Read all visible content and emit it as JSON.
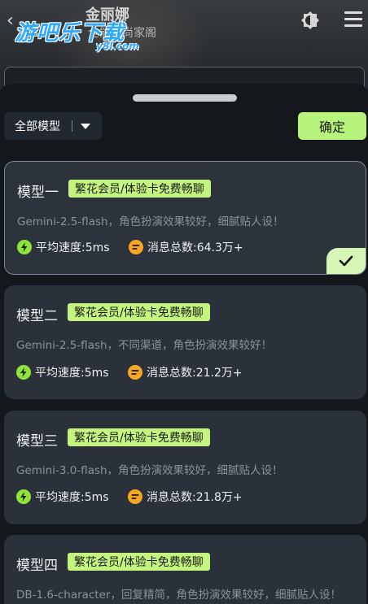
{
  "header": {
    "character_name": "金丽娜",
    "character_sub": "全能时尚家阁",
    "watermark_main": "游吧乐下载",
    "watermark_sub": "y8l.com"
  },
  "sheet": {
    "filter_label": "全部模型",
    "confirm_label": "确定"
  },
  "models": [
    {
      "title": "模型一",
      "badge": "繁花会员/体验卡免费畅聊",
      "description": "Gemini-2.5-flash，角色扮演效果较好，细腻贴人设！",
      "speed": "平均速度:5ms",
      "messages": "消息总数:64.3万+",
      "selected": true
    },
    {
      "title": "模型二",
      "badge": "繁花会员/体验卡免费畅聊",
      "description": "Gemini-2.5-flash，不同渠道，角色扮演效果较好！",
      "speed": "平均速度:5ms",
      "messages": "消息总数:21.2万+",
      "selected": false
    },
    {
      "title": "模型三",
      "badge": "繁花会员/体验卡免费畅聊",
      "description": "Gemini-3.0-flash，角色扮演效果较好，细腻贴人设！",
      "speed": "平均速度:5ms",
      "messages": "消息总数:21.8万+",
      "selected": false
    },
    {
      "title": "模型四",
      "badge": "繁花会员/体验卡免费畅聊",
      "description": "DB-1.6-character，回复精简，角色扮演效果较好，细腻贴人设！",
      "speed": "",
      "messages": "",
      "selected": false
    }
  ],
  "colors": {
    "accent_green": "#b6f47e",
    "badge_green": "#c4f57e",
    "speed_icon": "#8fe33a",
    "message_icon": "#f5a623"
  },
  "icons": [
    "back-icon",
    "theme-toggle-icon",
    "menu-icon",
    "caret-down-icon",
    "lightning-icon",
    "message-icon",
    "check-icon"
  ]
}
